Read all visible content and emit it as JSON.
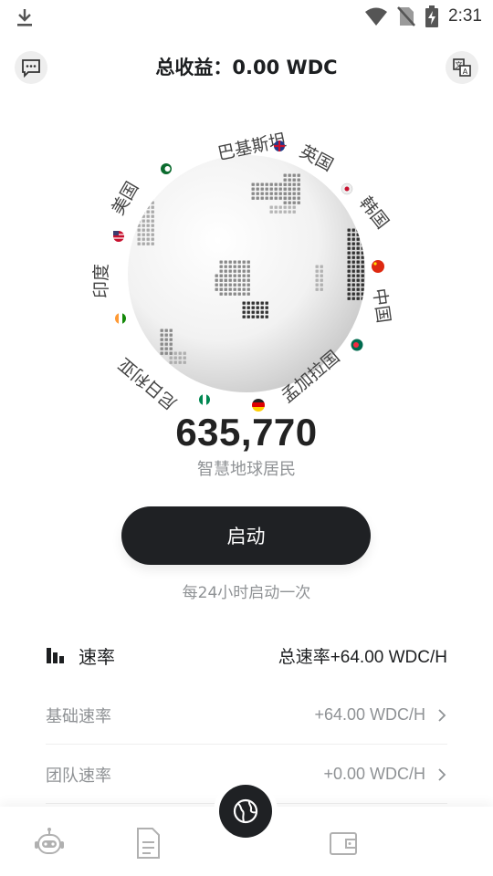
{
  "status_bar": {
    "time": "2:31",
    "icons": [
      "download-icon",
      "wifi-icon",
      "no-sim-icon",
      "battery-charging-icon"
    ]
  },
  "header": {
    "title": "总收益：0.00 WDC",
    "left_icon": "chat-icon",
    "right_icon": "translate-icon"
  },
  "globe": {
    "countries": [
      {
        "name": "巴基斯坦"
      },
      {
        "name": "英国"
      },
      {
        "name": "韩国"
      },
      {
        "name": "中国"
      },
      {
        "name": "孟加拉国"
      },
      {
        "name": "尼日利亚"
      },
      {
        "name": "印度"
      },
      {
        "name": "美国"
      }
    ],
    "flag_colors": {
      "pakistan": "#0b6b2e",
      "uk": "#c8102e",
      "korea": "#2452a6",
      "china": "#de2910",
      "bangladesh": "#006a4e",
      "germany": "#ffce00",
      "nigeria": "#008751",
      "india": "#ff9933",
      "usa": "#3c3b6e"
    }
  },
  "stats": {
    "count": "635,770",
    "count_label": "智慧地球居民"
  },
  "start": {
    "button_label": "启动",
    "hint": "每24小时启动一次"
  },
  "rate": {
    "title": "速率",
    "total": "总速率+64.00 WDC/H",
    "rows": [
      {
        "label": "基础速率",
        "value": "+64.00 WDC/H"
      },
      {
        "label": "团队速率",
        "value": "+0.00 WDC/H"
      }
    ]
  },
  "nav": {
    "items": [
      "robot-icon",
      "document-icon",
      "globe-icon",
      "wallet-icon"
    ]
  }
}
